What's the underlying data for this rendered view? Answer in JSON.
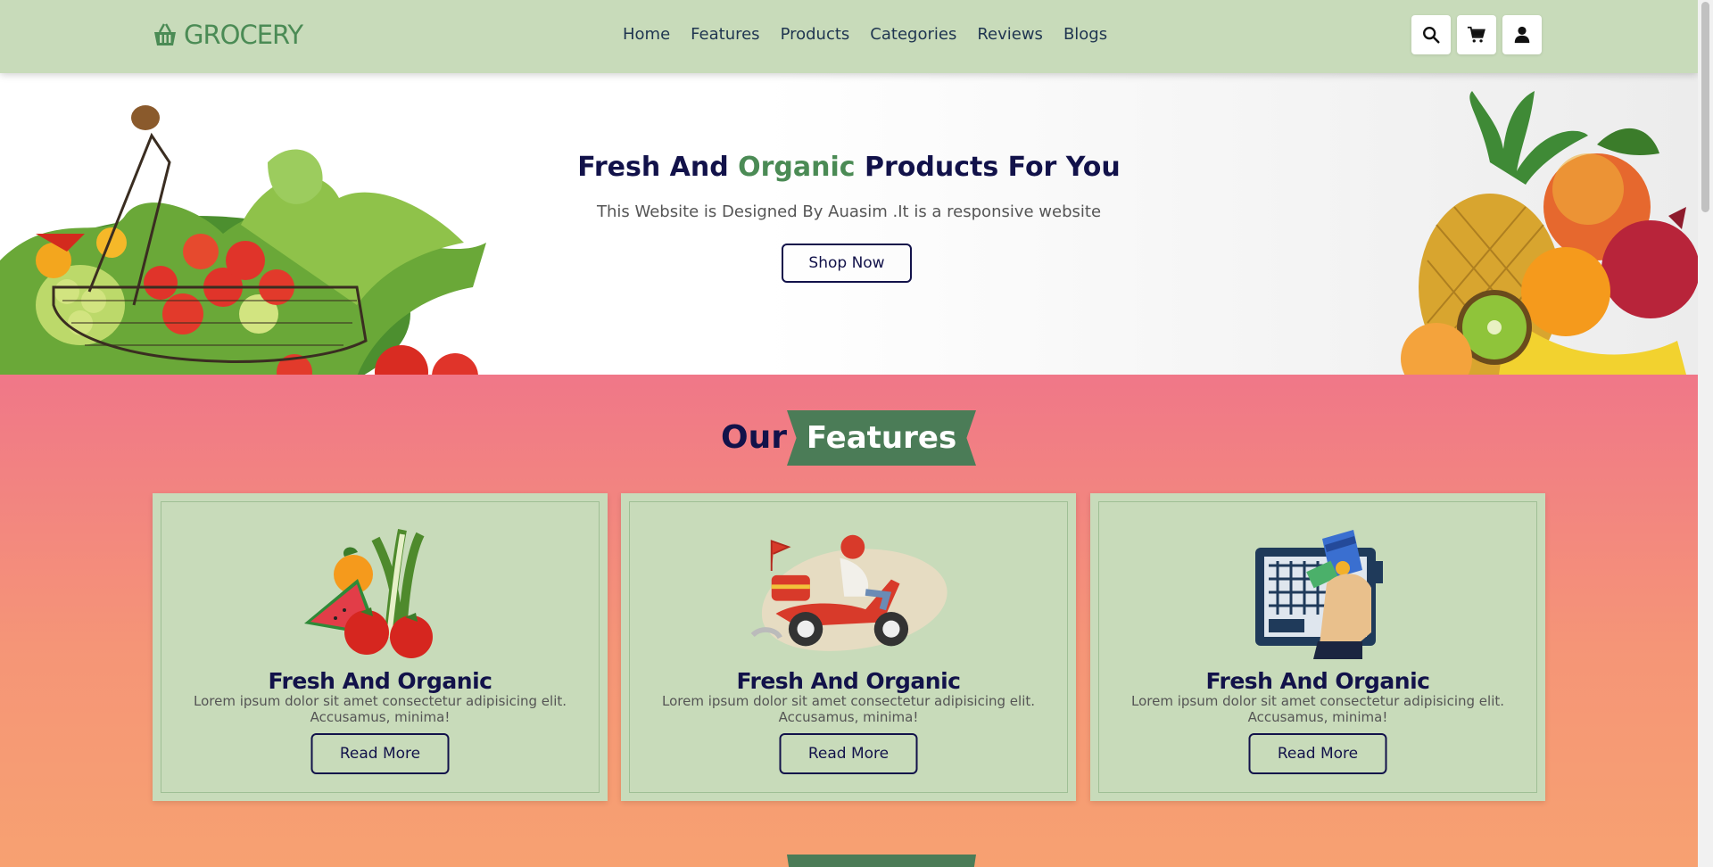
{
  "header": {
    "logo_text": "GROCERY",
    "nav": [
      "Home",
      "Features",
      "Products",
      "Categories",
      "Reviews",
      "Blogs"
    ],
    "icons": [
      "search-icon",
      "cart-icon",
      "user-icon"
    ]
  },
  "hero": {
    "title_part1": "Fresh And ",
    "title_highlight": "Organic",
    "title_part2": " Products For You",
    "subtitle": "This Website is Designed By Auasim .It is a responsive website",
    "button": "Shop Now"
  },
  "features": {
    "heading_our": "Our",
    "heading_ribbon": "Features",
    "cards": [
      {
        "title": "Fresh And Organic",
        "desc": "Lorem ipsum dolor sit amet consectetur adipisicing elit. Accusamus, minima!",
        "button": "Read More"
      },
      {
        "title": "Fresh And Organic",
        "desc": "Lorem ipsum dolor sit amet consectetur adipisicing elit. Accusamus, minima!",
        "button": "Read More"
      },
      {
        "title": "Fresh And Organic",
        "desc": "Lorem ipsum dolor sit amet consectetur adipisicing elit. Accusamus, minima!",
        "button": "Read More"
      }
    ]
  },
  "colors": {
    "header_bg": "#c8dbba",
    "brand_green": "#4b8b55",
    "navy": "#12124a",
    "section_gradient_top": "#f07788",
    "section_gradient_bottom": "#f7a171"
  }
}
